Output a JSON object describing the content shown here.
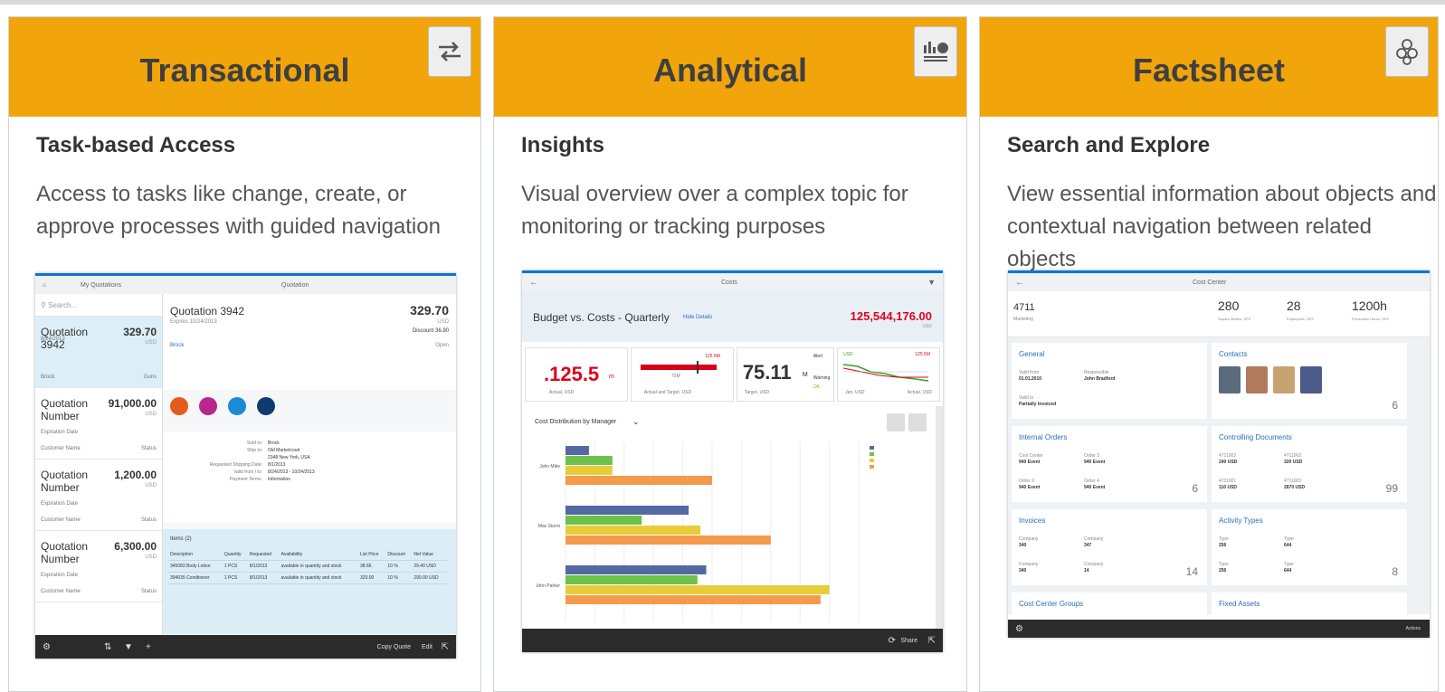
{
  "cards": [
    {
      "title": "Transactional",
      "icon": "swap-arrows-icon",
      "subtitle": "Task-based Access",
      "description": "Access to tasks like change, create, or approve processes with guided navigation",
      "screen": {
        "master_title": "My Quotations",
        "detail_title": "Quotation",
        "search_placeholder": "Search...",
        "list": [
          {
            "name": "Quotation 3942",
            "amount": "329.70",
            "currency": "USD",
            "sub": "8/24/2013",
            "left": "Brock",
            "right": "Guns"
          },
          {
            "name": "Quotation Number",
            "amount": "91,000.00",
            "currency": "USD",
            "sub": "Expiration Date",
            "left": "Customer Name",
            "right": "Status"
          },
          {
            "name": "Quotation Number",
            "amount": "1,200.00",
            "currency": "USD",
            "sub": "Expiration Date",
            "left": "Customer Name",
            "right": "Status"
          },
          {
            "name": "Quotation Number",
            "amount": "6,300.00",
            "currency": "USD",
            "sub": "Expiration Date",
            "left": "Customer Name",
            "right": "Status"
          }
        ],
        "detail": {
          "name": "Quotation 3942",
          "expires": "Expires 10/24/2013",
          "amount": "329.70",
          "currency": "USD",
          "discount": "Discount 36.90",
          "status": "Open",
          "customer": "Brock"
        },
        "form": [
          {
            "label": "Sold to:",
            "value": "Brock"
          },
          {
            "label": "Ship to:",
            "value": "Old Marketcourt"
          },
          {
            "label": "",
            "value": "2348 New York, USA"
          },
          {
            "label": "Requested Shipping Date:",
            "value": "8/1/2013"
          },
          {
            "label": "Valid from / to:",
            "value": "8/24/2013 - 10/24/2013"
          },
          {
            "label": "Payment Terms:",
            "value": "Information"
          }
        ],
        "items_title": "Items (2)",
        "items_columns": [
          "Description",
          "Quantity",
          "Requested",
          "Availability",
          "List Price",
          "Discount",
          "Net Value"
        ],
        "items_rows": [
          [
            "345083 Body Lotion",
            "1 PCS",
            "8/1/2013",
            "available in quantity and stock",
            "38.66",
            "10 %",
            "29.40 USD"
          ],
          [
            "394035 Conditioner",
            "1 PCS",
            "8/1/2013",
            "available in quantity and stock",
            "320.00",
            "10 %",
            "290.00 USD"
          ]
        ],
        "footer_right": [
          "Copy Quote",
          "Edit"
        ]
      }
    },
    {
      "title": "Analytical",
      "icon": "chart-report-icon",
      "subtitle": "Insights",
      "description": "Visual overview over a complex topic for monitoring or tracking purposes",
      "screen": {
        "header_title": "Costs",
        "kpi_title": "Budget vs. Costs - Quarterly",
        "kpi_link": "Hide Details",
        "kpi_value": "125,544,176.00",
        "kpi_unit": "USD",
        "tiles": [
          {
            "value": ".125.5",
            "unit": "m",
            "caption": "Actual, USD"
          },
          {
            "value": "",
            "unit": "",
            "caption": "Actual and Target, USD",
            "marker": "125.5M",
            "mid": "72M"
          },
          {
            "value": "75.11",
            "unit": "M",
            "caption": "Target, USD"
          },
          {
            "value": "",
            "unit": "",
            "caption": "Jan, USD",
            "caption2": "Actual, USD",
            "marker": "125.5M",
            "start": "USD"
          }
        ],
        "tile_side": [
          "Alert",
          "Warning",
          "OK"
        ],
        "chart_title": "Cost Distribution by Manager",
        "footer_right": [
          "Share"
        ]
      }
    },
    {
      "title": "Factsheet",
      "icon": "hexagon-cluster-icon",
      "subtitle": "Search and Explore",
      "description": "View essential information about objects and contextual navigation between related objects",
      "screen": {
        "header_title": "Cost Center",
        "object_id": "4711",
        "object_name": "Marketing",
        "kpis": [
          {
            "value": "280",
            "caption": "Square Meters, SFS"
          },
          {
            "value": "28",
            "caption": "Employees, SFS"
          },
          {
            "value": "1200h",
            "caption": "Production Hours, SFS"
          }
        ],
        "tiles": [
          {
            "title": "General",
            "count": "",
            "fields": [
              [
                "Valid from",
                "01.01.2010"
              ],
              [
                "Responsible",
                "John Bradford"
              ],
              [
                "Valid to",
                "Partially Invoiced"
              ]
            ]
          },
          {
            "title": "Contacts",
            "count": "6",
            "fields": []
          },
          {
            "title": "Internal Orders",
            "count": "6",
            "fields": [
              [
                "Cost Center",
                "940 Event"
              ],
              [
                "Order 3",
                "940 Event"
              ],
              [
                "Order 2",
                "940 Event"
              ],
              [
                "Order 4",
                "940 Event"
              ]
            ]
          },
          {
            "title": "Controlling Documents",
            "count": "99",
            "fields": [
              [
                "4711002",
                "240 USD"
              ],
              [
                "4711002",
                "320 USD"
              ],
              [
                "4711001",
                "110 USD"
              ],
              [
                "4711002",
                "2870 USD"
              ]
            ]
          },
          {
            "title": "Invoices",
            "count": "14",
            "fields": [
              [
                "Company",
                "340"
              ],
              [
                "Company",
                "347"
              ],
              [
                "Company",
                "340"
              ],
              [
                "Company",
                "14"
              ]
            ]
          },
          {
            "title": "Activity Types",
            "count": "8",
            "fields": [
              [
                "Type",
                "256"
              ],
              [
                "Type",
                "644"
              ],
              [
                "Type",
                "256"
              ],
              [
                "Type",
                "644"
              ]
            ]
          },
          {
            "title": "Cost Center Groups",
            "count": "",
            "fields": []
          },
          {
            "title": "Fixed Assets",
            "count": "",
            "fields": []
          }
        ],
        "footer_right": [
          "Actions"
        ]
      }
    }
  ],
  "chart_data": {
    "type": "bar",
    "title": "Cost Distribution by Manager",
    "categories": [
      "John Mike",
      "Max Storm",
      "John Parker"
    ],
    "series": [
      {
        "name": "",
        "color": "#5469a4",
        "values": [
          8,
          42,
          48
        ]
      },
      {
        "name": "",
        "color": "#6cc24a",
        "values": [
          16,
          26,
          45
        ]
      },
      {
        "name": "",
        "color": "#e8cd3a",
        "values": [
          16,
          46,
          90
        ]
      },
      {
        "name": "",
        "color": "#f49a4b",
        "values": [
          50,
          70,
          87
        ]
      }
    ],
    "xlim": [
      0,
      100
    ],
    "grid": true,
    "legend": "right"
  }
}
